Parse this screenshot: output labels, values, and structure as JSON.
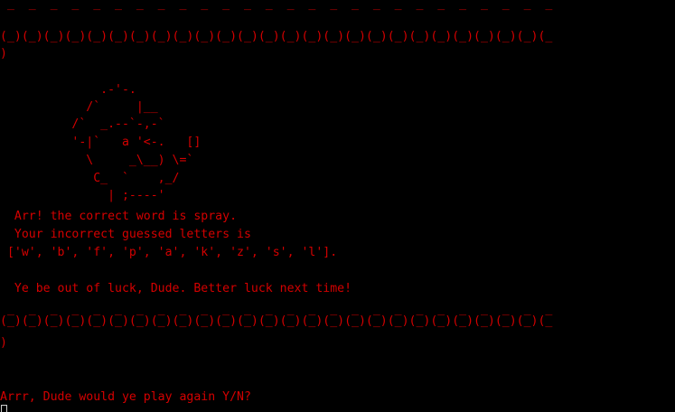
{
  "colors": {
    "background": "#000000",
    "text": "#d40000",
    "cursor": "#cfcfcf"
  },
  "terminal": {
    "lines": [
      " _  _  _  _  _  _  _  _  _  _  _  _  _  _  _  _  _  _  _  _  _  _  _  _  _  _",
      "",
      "(_)(_)(_)(_)(_)(_)(_)(_)(_)(_)(_)(_)(_)(_)(_)(_)(_)(_)(_)(_)(_)(_)(_)(_)(_)(_",
      ")",
      "",
      "              .-'-.",
      "            /`     |__",
      "          /`  _.--`-,-`",
      "          '-|`   a '<-.   []",
      "            \\     _\\__) \\=`",
      "             C_  `    ,_/",
      "               | ;----'",
      "  Arr! the correct word is spray.",
      "  Your incorrect guessed letters is",
      " ['w', 'b', 'f', 'p', 'a', 'k', 'z', 's', 'l'].",
      "",
      "  Ye be out of luck, Dude. Better luck next time!",
      "",
      " _  _  _  _  _  _  _  _  _  _  _  _  _  _  _  _  _  _  _  _  _  _  _  _  _  _",
      "(_)(_)(_)(_)(_)(_)(_)(_)(_)(_)(_)(_)(_)(_)(_)(_)(_)(_)(_)(_)(_)(_)(_)(_)(_)(_",
      ")",
      "",
      "Arrr, Dude would ye play again Y/N?"
    ]
  }
}
